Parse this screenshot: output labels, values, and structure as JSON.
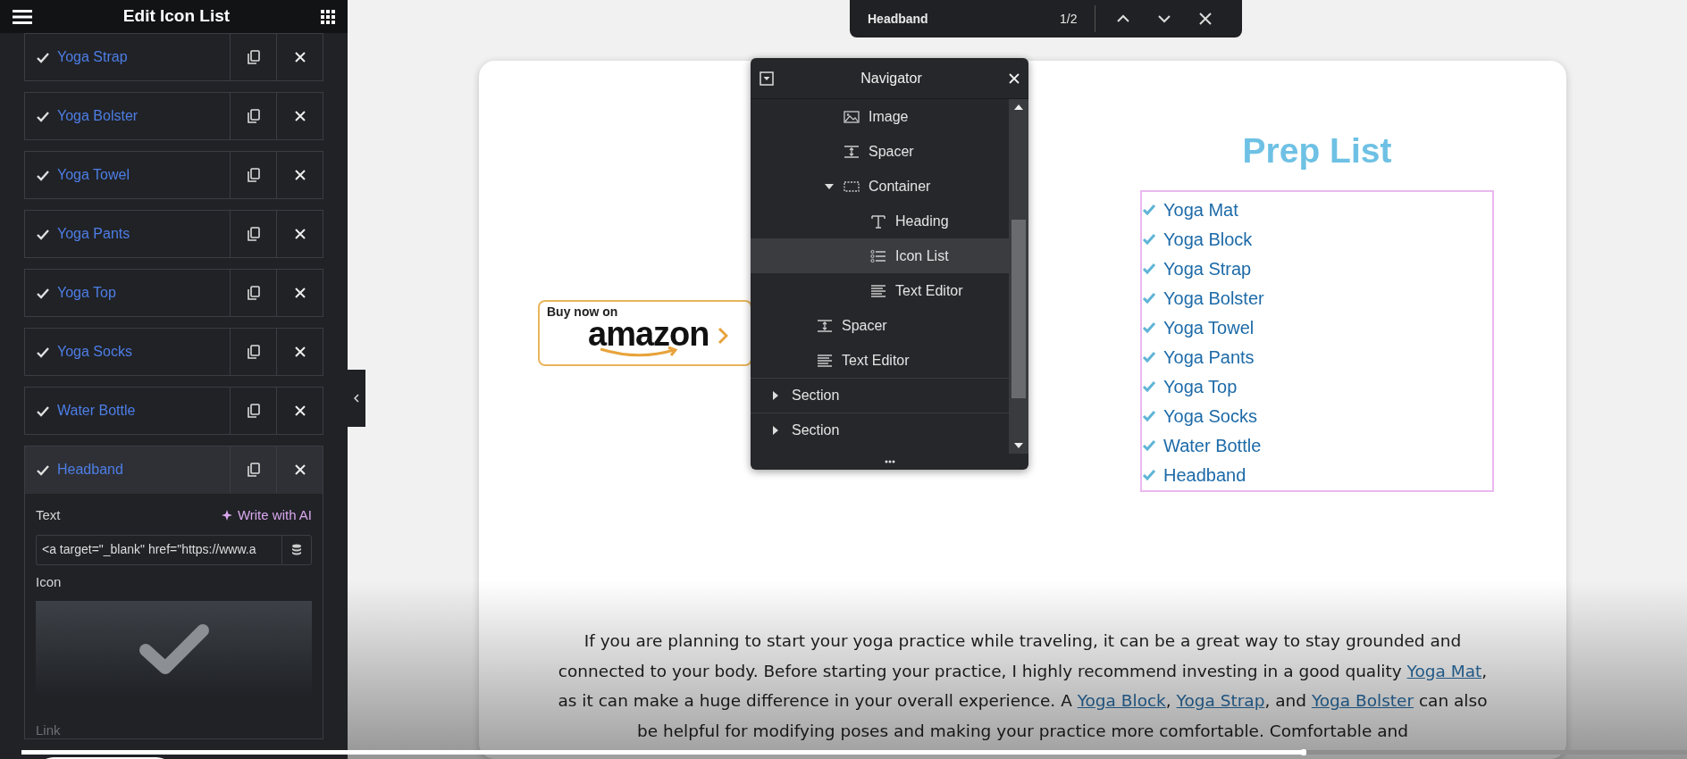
{
  "panel": {
    "title": "Edit Icon List",
    "items": [
      {
        "label": "Yoga Strap",
        "expanded": false
      },
      {
        "label": "Yoga Bolster",
        "expanded": false
      },
      {
        "label": "Yoga Towel",
        "expanded": false
      },
      {
        "label": "Yoga Pants",
        "expanded": false
      },
      {
        "label": "Yoga Top",
        "expanded": false
      },
      {
        "label": "Yoga Socks",
        "expanded": false
      },
      {
        "label": "Water Bottle",
        "expanded": false
      },
      {
        "label": "Headband",
        "expanded": true
      }
    ],
    "editor": {
      "text_label": "Text",
      "ai_button": "Write with AI",
      "text_value": "<a target=\"_blank\" href=\"https://www.a",
      "icon_label": "Icon",
      "link_label": "Link"
    }
  },
  "find_bar": {
    "query": "Headband",
    "count": "1/2"
  },
  "navigator": {
    "title": "Navigator",
    "tree": [
      {
        "children": [
          {
            "children": [
              {
                "label": "Image",
                "kind": "image",
                "selected": false
              },
              {
                "label": "Spacer",
                "kind": "spacer",
                "selected": false
              },
              {
                "label": "Container",
                "kind": "container",
                "selected": false,
                "expanded": true,
                "children": [
                  {
                    "label": "Heading",
                    "kind": "heading",
                    "selected": false
                  },
                  {
                    "label": "Icon List",
                    "kind": "list",
                    "selected": true
                  },
                  {
                    "label": "Text Editor",
                    "kind": "text",
                    "selected": false
                  }
                ]
              }
            ]
          },
          {
            "label": "Spacer",
            "kind": "spacer",
            "selected": false
          },
          {
            "label": "Text Editor",
            "kind": "text",
            "selected": false
          }
        ]
      },
      {
        "label": "Section",
        "selected": false,
        "expanded": false
      },
      {
        "label": "Section",
        "selected": false,
        "expanded": false
      }
    ]
  },
  "page": {
    "buy_button": {
      "caption": "Buy now on",
      "brand": "amazon"
    },
    "heading": "Prep List",
    "list": [
      "Yoga Mat",
      "Yoga Block",
      "Yoga Strap",
      "Yoga Bolster",
      "Yoga Towel",
      "Yoga Pants",
      "Yoga Top",
      "Yoga Socks",
      "Water Bottle",
      "Headband"
    ],
    "paragraph": [
      {
        "text": "If you are planning to start your yoga practice while traveling, it can be a great way to stay grounded and connected to your body. Before starting your practice, I highly recommend investing in a good quality ",
        "link": false
      },
      {
        "text": "Yoga Mat",
        "link": true
      },
      {
        "text": ", as it can make a huge difference in your overall experience. A ",
        "link": false
      },
      {
        "text": "Yoga Block",
        "link": true
      },
      {
        "text": ", ",
        "link": false
      },
      {
        "text": "Yoga Strap",
        "link": true
      },
      {
        "text": ", and ",
        "link": false
      },
      {
        "text": "Yoga Bolster",
        "link": true
      },
      {
        "text": " can also be helpful for modifying poses and making your practice more comfortable. Comfortable and",
        "link": false
      }
    ]
  },
  "video_progress": {
    "level": 0.77
  }
}
